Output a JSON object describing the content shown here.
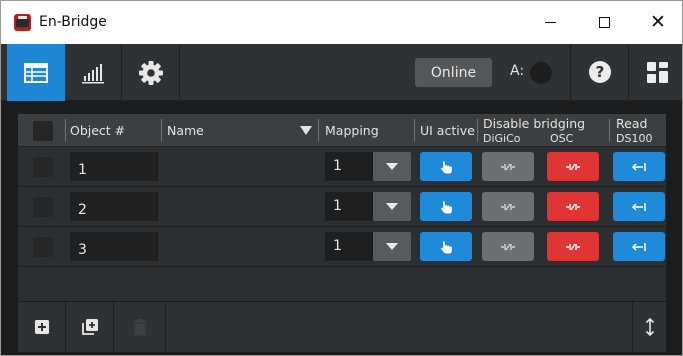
{
  "window": {
    "title": "En-Bridge",
    "minimize_icon": "minimize-icon",
    "maximize_icon": "maximize-icon",
    "close_icon": "close-icon",
    "close_glyph": "✕"
  },
  "toolbar": {
    "tabs": [
      {
        "icon": "table-icon",
        "active": true
      },
      {
        "icon": "bar-chart-icon",
        "active": false
      },
      {
        "icon": "gear-icon",
        "active": false
      }
    ],
    "online_label": "Online",
    "a_label": "A:",
    "help_glyph": "?",
    "layout_icon": "grid-layout-icon"
  },
  "table": {
    "columns": {
      "object": "Object #",
      "name": "Name",
      "mapping": "Mapping",
      "ui_active": "UI active",
      "disable_bridging": "Disable bridging",
      "digico": "DiGiCo",
      "osc": "OSC",
      "read": "Read",
      "ds100": "DS100"
    },
    "rows": [
      {
        "object": "1",
        "name": "",
        "mapping": "1"
      },
      {
        "object": "2",
        "name": "",
        "mapping": "1"
      },
      {
        "object": "3",
        "name": "",
        "mapping": "1"
      }
    ]
  },
  "bottombar": {
    "add_icon": "add-icon",
    "duplicate_icon": "duplicate-icon",
    "delete_icon": "trash-icon",
    "resize_icon": "resize-vertical-icon",
    "resize_glyph": "↕"
  },
  "colors": {
    "accent_blue": "#1f8ad8",
    "bridging_red": "#e03535",
    "panel_dark": "#2c2f31",
    "toolbar_bg": "#2f3234"
  }
}
